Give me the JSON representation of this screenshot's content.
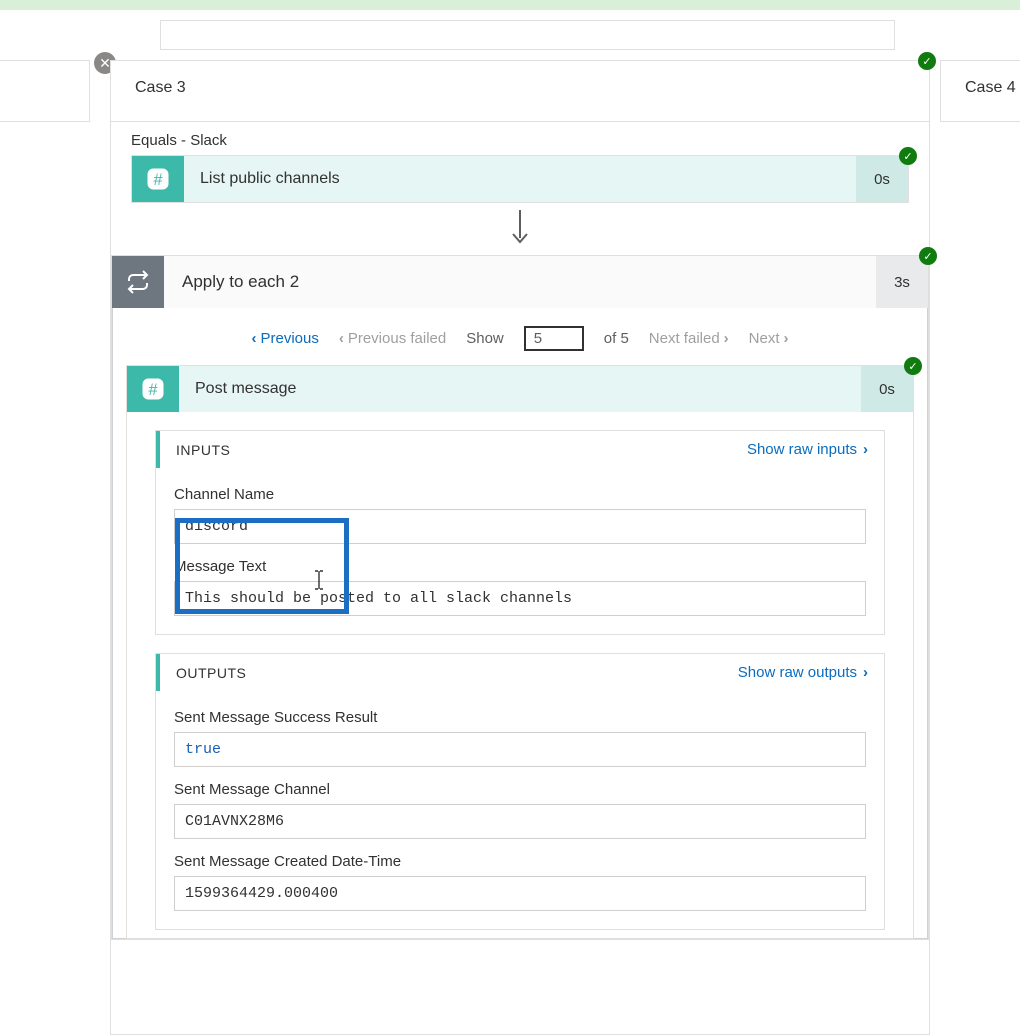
{
  "cases": {
    "c3": "Case 3",
    "c4": "Case 4"
  },
  "condition_label": "Equals - Slack",
  "actions": {
    "list_channels": {
      "title": "List public channels",
      "duration": "0s"
    },
    "apply_each": {
      "title": "Apply to each 2",
      "duration": "3s"
    },
    "post_message": {
      "title": "Post message",
      "duration": "0s"
    }
  },
  "pager": {
    "previous": "Previous",
    "previous_failed": "Previous failed",
    "show_label": "Show",
    "current": "5",
    "of_total": "of 5",
    "next_failed": "Next failed",
    "next": "Next"
  },
  "inputs": {
    "header": "INPUTS",
    "raw_link": "Show raw inputs",
    "fields": {
      "channel_name": {
        "label": "Channel Name",
        "value": "discord"
      },
      "message_text": {
        "label": "Message Text",
        "value": "This should be posted to all slack channels"
      }
    }
  },
  "outputs": {
    "header": "OUTPUTS",
    "raw_link": "Show raw outputs",
    "fields": {
      "success": {
        "label": "Sent Message Success Result",
        "value": "true"
      },
      "channel": {
        "label": "Sent Message Channel",
        "value": "C01AVNX28M6"
      },
      "created": {
        "label": "Sent Message Created Date-Time",
        "value": "1599364429.000400"
      }
    }
  }
}
